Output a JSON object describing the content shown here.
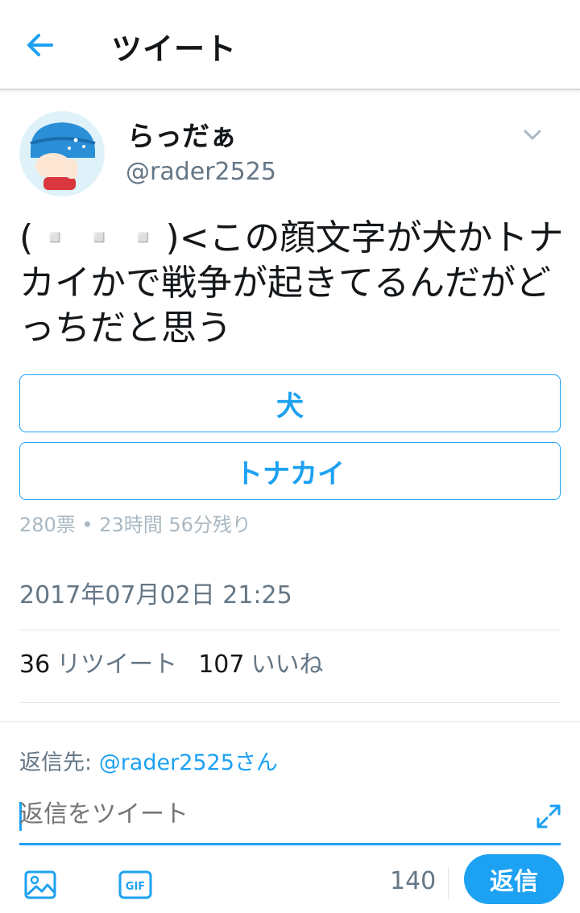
{
  "header": {
    "title": "ツイート"
  },
  "tweet": {
    "display_name": "らっだぁ",
    "username": "@rader2525",
    "text": "(▫️▫️▫️)<この顔文字が犬かトナカイかで戦争が起きてるんだがどっちだと思う",
    "poll": {
      "options": [
        "犬",
        "トナカイ"
      ],
      "meta": "280票 • 23時間 56分残り"
    },
    "timestamp": "2017年07月02日 21:25",
    "stats": {
      "retweets_count": "36",
      "retweets_label": "リツイート",
      "likes_count": "107",
      "likes_label": "いいね"
    }
  },
  "reply": {
    "reply_to_label": "返信先:",
    "reply_to_handle": "@rader2525さん",
    "placeholder": "返信をツイート",
    "char_count": "140",
    "submit_label": "返信"
  },
  "colors": {
    "accent": "#1da1f2",
    "muted": "#657786",
    "text": "#14171a"
  },
  "icons": [
    "back-arrow-icon",
    "chevron-down-icon",
    "expand-icon",
    "image-icon",
    "gif-icon"
  ]
}
